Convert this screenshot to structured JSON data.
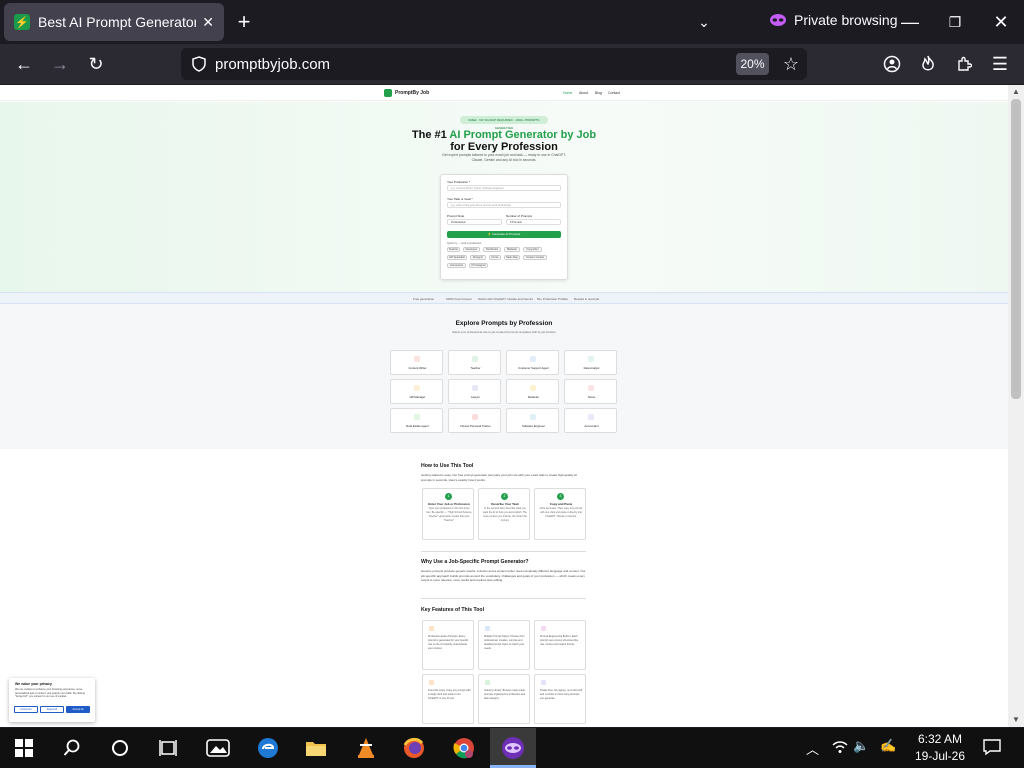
{
  "browser": {
    "tab_title": "Best AI Prompt Generator by Jo",
    "private_label": "Private browsing",
    "url": "promptbyjob.com",
    "zoom": "20%"
  },
  "site": {
    "brand": "PromptBy Job",
    "nav": [
      "Home",
      "About",
      "Blog",
      "Contact"
    ],
    "hero": {
      "badge": "FREE · NO SIGNUP REQUIRED · 1000+ PROMPTS GENERATED",
      "title_pre": "The #1 ",
      "title_accent": "AI Prompt Generator by Job",
      "title_line2": "for Every Profession",
      "subtitle": "Get expert prompts tailored to your exact job and task — ready to use in ChatGPT, Claude, Gemini and any AI tool in seconds."
    },
    "form": {
      "profession_label": "Your Profession *",
      "profession_placeholder": "e.g. Content Writer, Nurse, Software Engineer",
      "task_label": "Your Task or Goal *",
      "task_placeholder": "e.g. write a blog post about remote work productivity",
      "tone_label": "Prompt Style",
      "tone_value": "Professional",
      "count_label": "Number of Prompts",
      "count_value": "5 Prompts",
      "generate_label": "⚡ Generate AI Prompts",
      "quick_label": "Quick try — click a profession:",
      "chips": [
        "Teacher",
        "Developer",
        "Nutritionist",
        "Marketer",
        "Copywriter",
        "HR Specialist",
        "Designer",
        "Nurse",
        "Sales Rep",
        "Content Creator",
        "Accountant",
        "UX Designer"
      ]
    },
    "strip": [
      "Free generation",
      "100% Free Forever",
      "Works with ChatGPT, Claude and Gemini",
      "50+ Profession Profiles",
      "Results in seconds"
    ],
    "explore": {
      "title": "Explore Prompts by Profession",
      "subtitle": "Select your professional role to get curated AI prompt templates built by job function",
      "cards": [
        "Content Writer",
        "Teacher",
        "Customer Support Agent",
        "Data Analyst",
        "HR Manager",
        "Lawyer",
        "Marketer",
        "Nurse",
        "Real Estate Agent",
        "Fitness Personal Trainer",
        "Software Engineer",
        "Accountant"
      ]
    },
    "howto": {
      "title": "How to Use This Tool",
      "intro": "Getting started is easy. Our free prompt generator tool pairs your job role with your exact task to create high-quality AI prompts in seconds. Here's exactly how it works:",
      "steps": [
        {
          "num": "1",
          "title": "Enter Your Job or Profession",
          "desc": "Type your profession in the first input box. Be specific — \"High School Science Teacher\" gets better results than just \"Teacher\"."
        },
        {
          "num": "2",
          "title": "Describe Your Task",
          "desc": "In the second field, describe what you want the AI to help you accomplish. The more context you include, the better the prompt."
        },
        {
          "num": "3",
          "title": "Copy and Paste",
          "desc": "Click Generate. Then copy any prompt with one click and paste it directly into ChatGPT, Claude or Gemini."
        }
      ]
    },
    "why": {
      "title": "Why Use a Job-Specific Prompt Generator?",
      "text": "Generic prompts produce generic results. A doctor and a content writer need completely different language and context. Our job-specific approach builds prompts around the vocabulary, challenges and goals of your profession — which means every output is more relevant, more useful and requires less editing."
    },
    "features": {
      "title": "Key Features of This Tool",
      "items": [
        "Profession-aware Prompts: Every prompt is generated for your specific role so the AI instantly understands your context.",
        "Multiple Prompt Styles: Choose from professional, creative, concise and detailed prompt styles to match your needs.",
        "Prompt Engineering Built-In: Each prompt uses proven structures like role, context and output format.",
        "One-click Copy: Copy any prompt with a single click and paste it into ChatGPT or any AI tool.",
        "Industry Library: Browse ready-made prompts organized by profession and task category.",
        "Totally Free: No signup, no credit card and no limits on how many prompts you generate."
      ]
    },
    "cookie": {
      "title": "We value your privacy",
      "text": "We use cookies to enhance your browsing experience, serve personalized ads or content, and analyze our traffic. By clicking \"Accept All\", you consent to our use of cookies.",
      "customize": "Customize",
      "reject": "Reject All",
      "accept": "Accept All"
    }
  },
  "taskbar": {
    "time": "6:32 AM",
    "date": "19-Jul-26"
  },
  "colors": {
    "brand_green": "#22a04b",
    "chrome_dark": "#1c1b22",
    "chrome_mid": "#2b2a33",
    "private_purple": "#c45cf6"
  }
}
